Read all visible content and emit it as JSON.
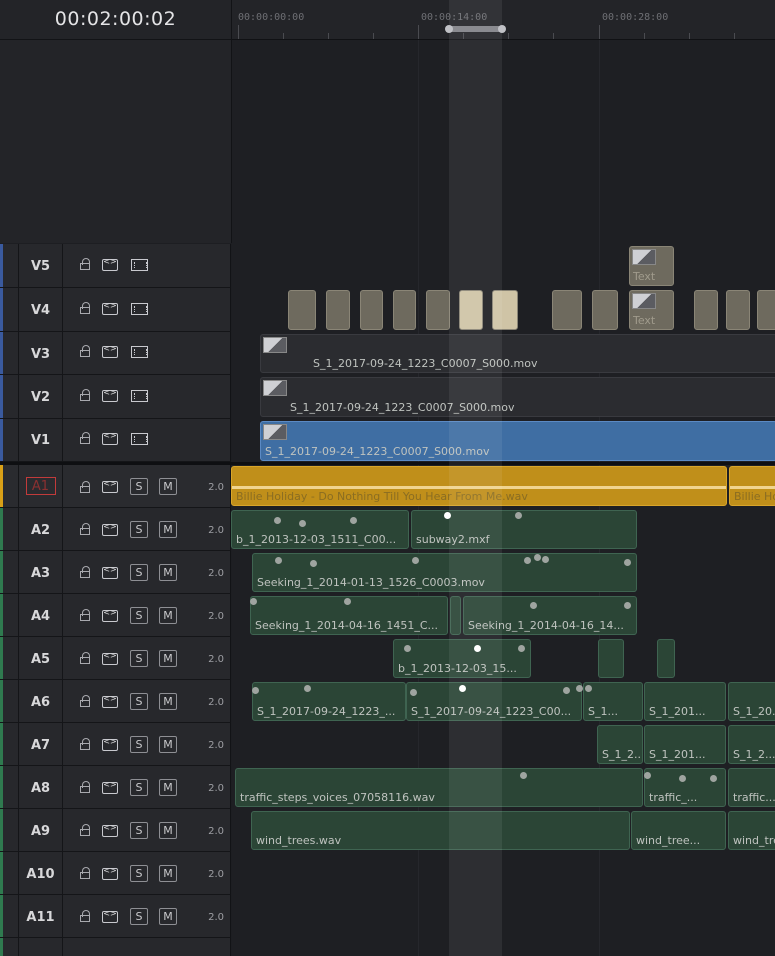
{
  "timecode": "00:02:00:02",
  "ruler": {
    "labels": [
      "00:00:00:00",
      "00:00:14:00",
      "00:00:28:00"
    ]
  },
  "video_tracks": [
    {
      "name": "V5"
    },
    {
      "name": "V4"
    },
    {
      "name": "V3"
    },
    {
      "name": "V2"
    },
    {
      "name": "V1"
    }
  ],
  "audio_tracks": [
    {
      "name": "A1",
      "s": "S",
      "m": "M",
      "vol": "2.0"
    },
    {
      "name": "A2",
      "s": "S",
      "m": "M",
      "vol": "2.0"
    },
    {
      "name": "A3",
      "s": "S",
      "m": "M",
      "vol": "2.0"
    },
    {
      "name": "A4",
      "s": "S",
      "m": "M",
      "vol": "2.0"
    },
    {
      "name": "A5",
      "s": "S",
      "m": "M",
      "vol": "2.0"
    },
    {
      "name": "A6",
      "s": "S",
      "m": "M",
      "vol": "2.0"
    },
    {
      "name": "A7",
      "s": "S",
      "m": "M",
      "vol": "2.0"
    },
    {
      "name": "A8",
      "s": "S",
      "m": "M",
      "vol": "2.0"
    },
    {
      "name": "A9",
      "s": "S",
      "m": "M",
      "vol": "2.0"
    },
    {
      "name": "A10",
      "s": "S",
      "m": "M",
      "vol": "2.0"
    },
    {
      "name": "A11",
      "s": "S",
      "m": "M",
      "vol": "2.0"
    }
  ],
  "clips": {
    "v5_text": "Text",
    "v4_text": "Text",
    "v3": "S_1_2017-09-24_1223_C0007_S000.mov",
    "v2": "S_1_2017-09-24_1223_C0007_S000.mov",
    "v1": "S_1_2017-09-24_1223_C0007_S000.mov",
    "a1_a": "Billie Holiday - Do Nothing Till You Hear From Me.wav",
    "a1_b": "Billie Ho",
    "a2_a": "b_1_2013-12-03_1511_C00...",
    "a2_b": "subway2.mxf",
    "a3": "Seeking_1_2014-01-13_1526_C0003.mov",
    "a4_a": "Seeking_1_2014-04-16_1451_C...",
    "a4_b": "Seeking_1_2014-04-16_14...",
    "a5": "b_1_2013-12-03_15...",
    "a6_a": "S_1_2017-09-24_1223_...",
    "a6_b": "S_1_2017-09-24_1223_C00...",
    "a6_c": "S_1...",
    "a6_d": "S_1_201...",
    "a6_e": "S_1_20...",
    "a7_a": "S_1_2...",
    "a7_b": "S_1_201...",
    "a7_c": "S_1_2...",
    "a8_a": "traffic_steps_voices_07058116.wav",
    "a8_b": "traffic_...",
    "a8_c": "traffic...",
    "a9_a": "wind_trees.wav",
    "a9_b": "wind_tree...",
    "a9_c": "wind_tre"
  },
  "colors": {
    "video": "#3a5a9e",
    "audio": "#2f7a4f",
    "a1": "#d9a017",
    "selected_clip": "#3f6ea3"
  }
}
